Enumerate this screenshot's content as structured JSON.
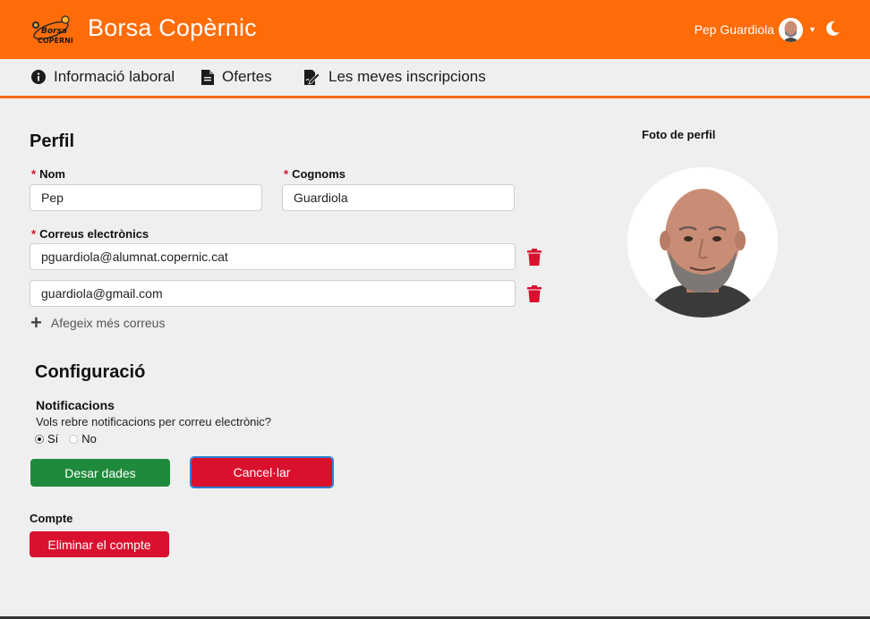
{
  "header": {
    "app_title": "Borsa Copèrnic",
    "logo_text": "Borsa Copèrnic",
    "user_name": "Pep Guardiola",
    "brand_color": "#ff6c08"
  },
  "nav": {
    "items": [
      {
        "label": "Informació laboral",
        "icon": "info-circle-icon"
      },
      {
        "label": "Ofertes",
        "icon": "document-icon"
      },
      {
        "label": "Les meves inscripcions",
        "icon": "signature-icon"
      }
    ]
  },
  "profile": {
    "title": "Perfil",
    "required_mark": "*",
    "name_label": "Nom",
    "name_value": "Pep",
    "surname_label": "Cognoms",
    "surname_value": "Guardiola",
    "emails_label": "Correus electrònics",
    "emails": [
      "pguardiola@alumnat.copernic.cat",
      "guardiola@gmail.com"
    ],
    "add_emails_label": "Afegeix més correus"
  },
  "config": {
    "title": "Configuració",
    "notifications_title": "Notificacions",
    "notifications_question": "Vols rebre notificacions per correu electrònic?",
    "option_yes": "Sí",
    "option_no": "No",
    "selected": "Sí"
  },
  "actions": {
    "save_label": "Desar dades",
    "cancel_label": "Cancel·lar"
  },
  "account": {
    "title": "Compte",
    "delete_label": "Eliminar el compte"
  },
  "photo": {
    "label": "Foto de perfil"
  },
  "colors": {
    "save": "#1f8a3b",
    "danger": "#d9102e",
    "focus": "#2d7fd6"
  }
}
